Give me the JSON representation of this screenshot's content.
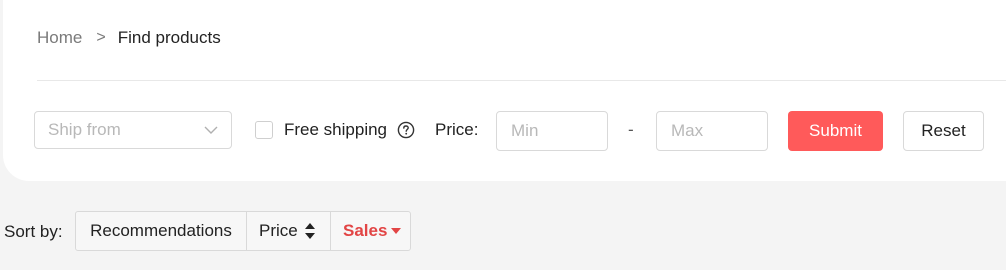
{
  "breadcrumb": {
    "home": "Home",
    "separator": ">",
    "current": "Find products"
  },
  "filters": {
    "ship_from_placeholder": "Ship from",
    "free_shipping_label": "Free shipping",
    "free_shipping_checked": false,
    "price_label": "Price:",
    "min_placeholder": "Min",
    "range_separator": "-",
    "max_placeholder": "Max",
    "submit_label": "Submit",
    "reset_label": "Reset"
  },
  "sort": {
    "label": "Sort by:",
    "options": [
      "Recommendations",
      "Price",
      "Sales"
    ],
    "active": "Sales"
  },
  "colors": {
    "accent": "#ff5a5a",
    "active_sort": "#e24545",
    "background": "#f4f4f4"
  },
  "icons": [
    "chevron-down-icon",
    "help-circle-icon",
    "sort-updown-icon",
    "caret-down-icon"
  ]
}
